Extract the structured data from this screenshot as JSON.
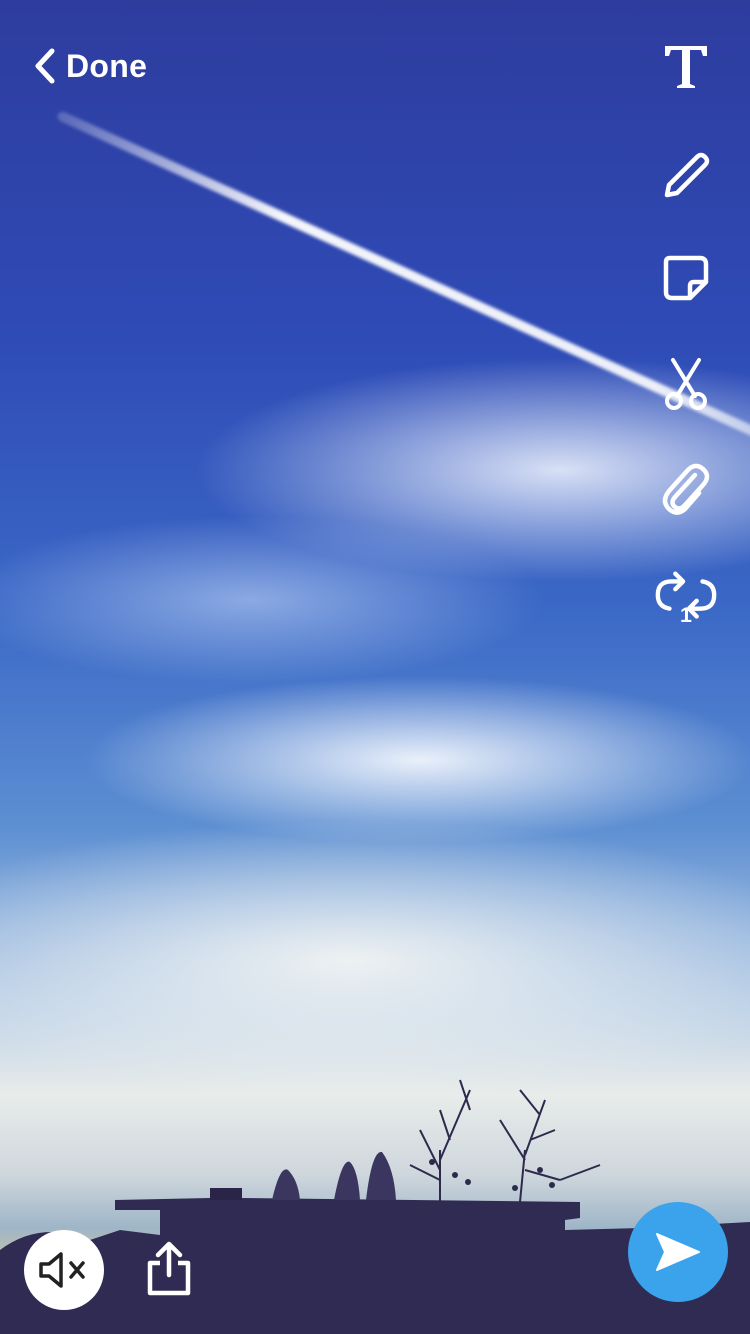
{
  "header": {
    "done_label": "Done",
    "back_icon": "chevron-left-icon"
  },
  "toolbar": {
    "tools": [
      {
        "name": "text-tool",
        "icon": "text-icon"
      },
      {
        "name": "draw-tool",
        "icon": "pencil-icon"
      },
      {
        "name": "sticker-tool",
        "icon": "sticker-icon"
      },
      {
        "name": "scissors-tool",
        "icon": "scissors-icon"
      },
      {
        "name": "attach-link-tool",
        "icon": "paperclip-icon"
      },
      {
        "name": "loop-tool",
        "icon": "loop-icon"
      }
    ],
    "loop_count_label": "1"
  },
  "bottom_bar": {
    "mute_icon": "speaker-muted-icon",
    "share_icon": "share-icon",
    "send_icon": "send-arrow-icon"
  },
  "colors": {
    "overlay_icons": "#ffffff",
    "send_button": "#3aa3ec",
    "mute_button_bg": "#ffffff"
  }
}
